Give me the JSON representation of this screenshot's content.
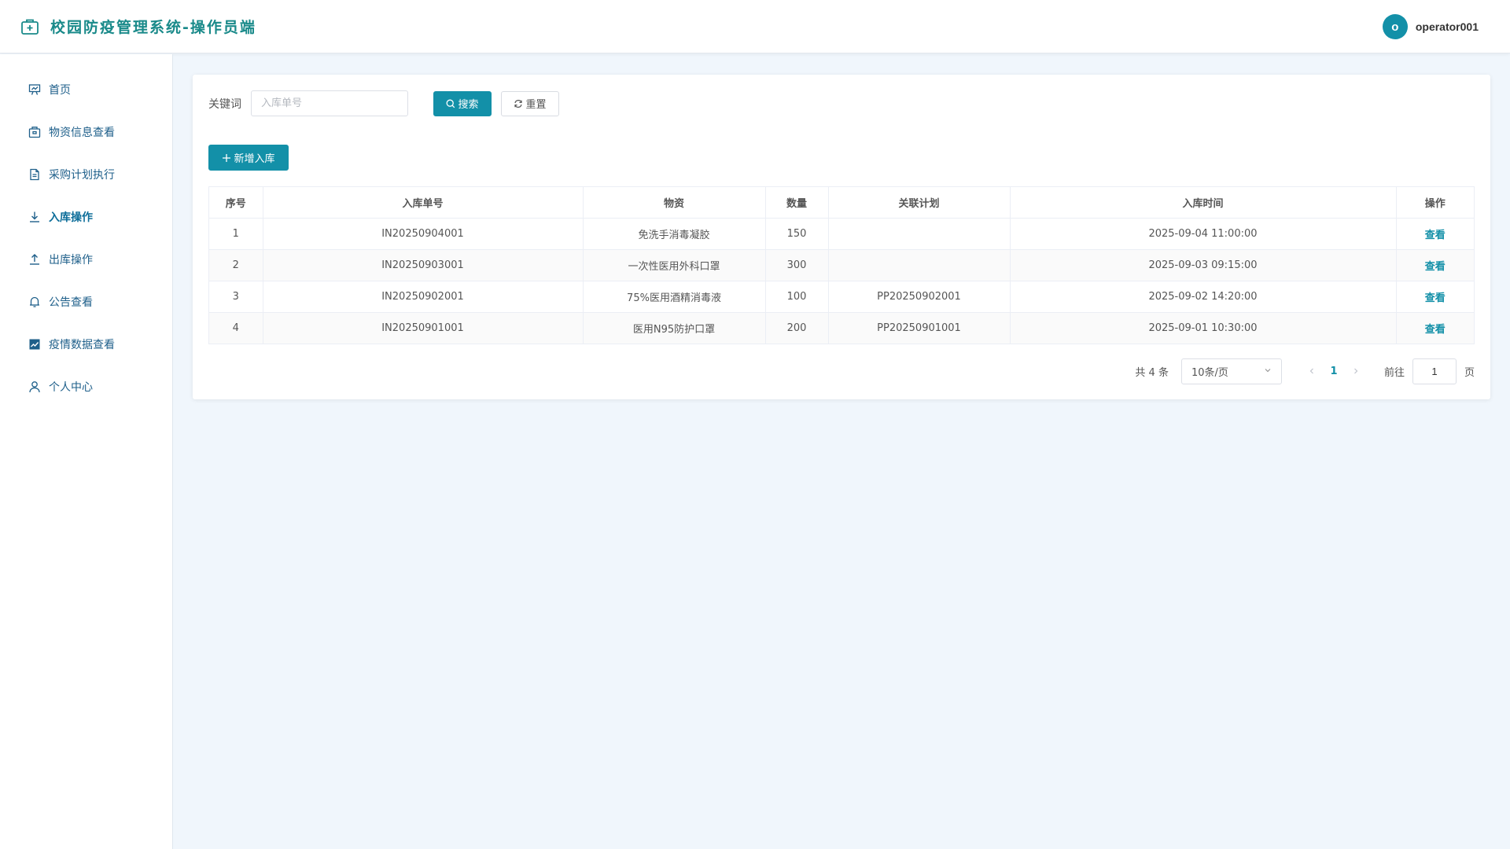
{
  "header": {
    "title": "校园防疫管理系统-操作员端",
    "avatar_letter": "o",
    "username": "operator001"
  },
  "sidebar": {
    "items": [
      {
        "label": "首页",
        "icon": "presentation-icon"
      },
      {
        "label": "物资信息查看",
        "icon": "box-icon"
      },
      {
        "label": "采购计划执行",
        "icon": "document-icon"
      },
      {
        "label": "入库操作",
        "icon": "download-icon",
        "active": true
      },
      {
        "label": "出库操作",
        "icon": "upload-icon"
      },
      {
        "label": "公告查看",
        "icon": "bell-icon"
      },
      {
        "label": "疫情数据查看",
        "icon": "chart-icon"
      },
      {
        "label": "个人中心",
        "icon": "user-icon"
      }
    ]
  },
  "search": {
    "label": "关键词",
    "placeholder": "入库单号",
    "value": "",
    "search_button": "搜索",
    "reset_button": "重置"
  },
  "toolbar": {
    "add_button": "新增入库"
  },
  "table": {
    "columns": [
      "序号",
      "入库单号",
      "物资",
      "数量",
      "关联计划",
      "入库时间",
      "操作"
    ],
    "rows": [
      {
        "index": "1",
        "order_no": "IN20250904001",
        "material": "免洗手消毒凝胶",
        "quantity": "150",
        "plan": "",
        "time": "2025-09-04 11:00:00",
        "action": "查看"
      },
      {
        "index": "2",
        "order_no": "IN20250903001",
        "material": "一次性医用外科口罩",
        "quantity": "300",
        "plan": "",
        "time": "2025-09-03 09:15:00",
        "action": "查看"
      },
      {
        "index": "3",
        "order_no": "IN20250902001",
        "material": "75%医用酒精消毒液",
        "quantity": "100",
        "plan": "PP20250902001",
        "time": "2025-09-02 14:20:00",
        "action": "查看"
      },
      {
        "index": "4",
        "order_no": "IN20250901001",
        "material": "医用N95防护口罩",
        "quantity": "200",
        "plan": "PP20250901001",
        "time": "2025-09-01 10:30:00",
        "action": "查看"
      }
    ]
  },
  "pagination": {
    "total_text": "共 4 条",
    "page_size": "10条/页",
    "current_page": "1",
    "goto_label": "前往",
    "goto_value": "1",
    "goto_suffix": "页"
  },
  "colors": {
    "accent": "#1390a8",
    "brand_title": "#1a8a8a",
    "background": "#f0f6fc"
  }
}
